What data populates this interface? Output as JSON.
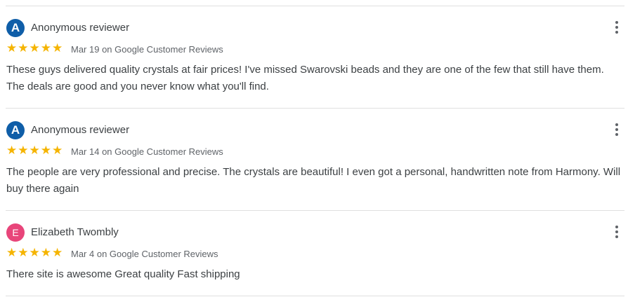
{
  "reviews": [
    {
      "avatar_letter": "A",
      "avatar_color": "#0f5ea8",
      "name": "Anonymous reviewer",
      "rating": 5,
      "stars": "★★★★★",
      "meta": "Mar 19 on Google Customer Reviews",
      "text": "These guys delivered quality crystals at fair prices! I've missed Swarovski beads and they are one of the few that still have them. The deals are good and you never know what you'll find."
    },
    {
      "avatar_letter": "A",
      "avatar_color": "#0f5ea8",
      "name": "Anonymous reviewer",
      "rating": 5,
      "stars": "★★★★★",
      "meta": "Mar 14 on Google Customer Reviews",
      "text": "The people are very professional and precise. The crystals are beautiful! I even got a personal, handwritten note from Harmony. Will buy there again"
    },
    {
      "avatar_letter": "E",
      "avatar_color": "#e8457a",
      "name": "Elizabeth Twombly",
      "rating": 5,
      "stars": "★★★★★",
      "meta": "Mar 4 on Google Customer Reviews",
      "text": "There site is awesome Great quality Fast shipping"
    }
  ],
  "colors": {
    "star": "#f5b400",
    "divider": "#e0e0e0",
    "text": "#3c4043",
    "meta": "#5f6368"
  },
  "icons": {
    "more": "more-vert-icon"
  }
}
